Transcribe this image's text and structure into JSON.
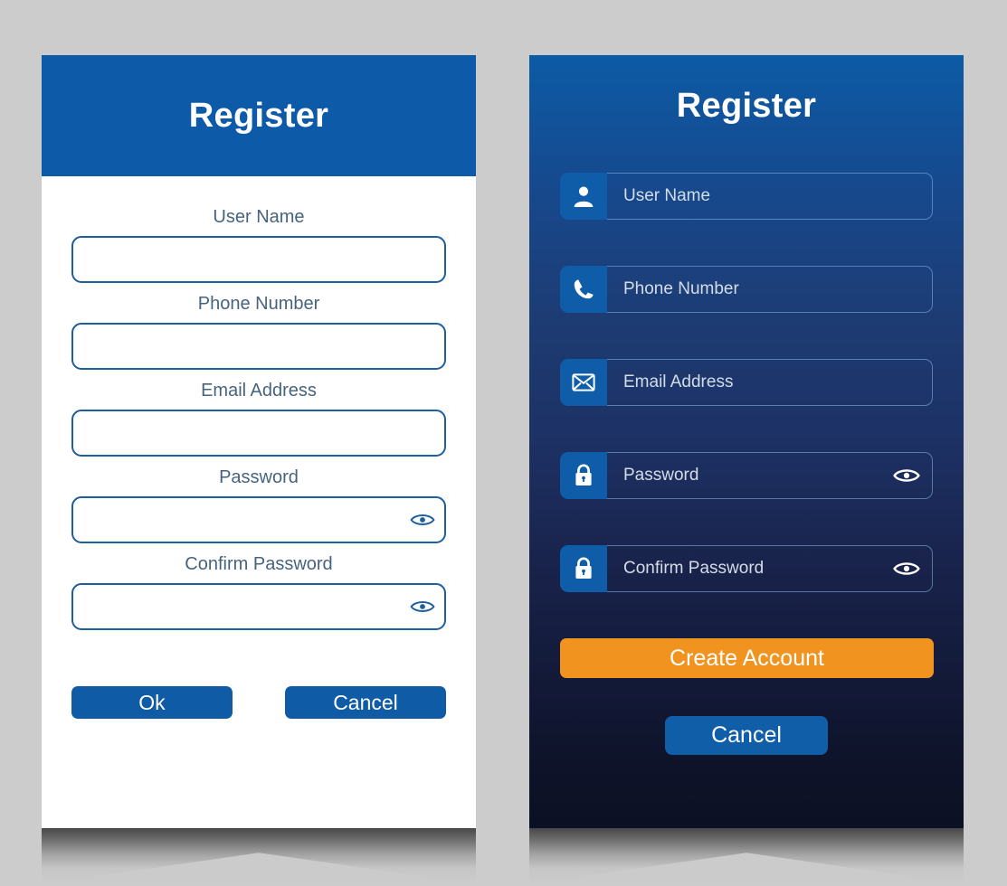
{
  "page": {
    "background_color": "#cccccc",
    "brand_blue": "#0d5ba8",
    "accent_orange": "#f0941f",
    "label_color": "#46637f"
  },
  "light_card": {
    "title": "Register",
    "header_color": "#0d5ba8",
    "fields": [
      {
        "label": "User Name",
        "value": "",
        "placeholder": "",
        "icon": "",
        "has_eye": false
      },
      {
        "label": "Phone Number",
        "value": "",
        "placeholder": "",
        "icon": "",
        "has_eye": false
      },
      {
        "label": "Email Address",
        "value": "",
        "placeholder": "",
        "icon": "",
        "has_eye": false
      },
      {
        "label": "Password",
        "value": "",
        "placeholder": "",
        "icon": "",
        "has_eye": true,
        "eye_icon": "eye-icon"
      },
      {
        "label": "Confirm Password",
        "value": "",
        "placeholder": "",
        "icon": "",
        "has_eye": true,
        "eye_icon": "eye-icon"
      }
    ],
    "buttons": {
      "ok": "Ok",
      "cancel": "Cancel"
    }
  },
  "dark_card": {
    "title": "Register",
    "gradient_top": "#0c5ba6",
    "gradient_bottom": "#0c1024",
    "fields": [
      {
        "placeholder": "User Name",
        "value": "",
        "icon": "user-icon",
        "has_eye": false
      },
      {
        "placeholder": "Phone Number",
        "value": "",
        "icon": "phone-icon",
        "has_eye": false
      },
      {
        "placeholder": "Email Address",
        "value": "",
        "icon": "envelope-icon",
        "has_eye": false
      },
      {
        "placeholder": "Password",
        "value": "",
        "icon": "lock-icon",
        "has_eye": true,
        "eye_icon": "eye-icon"
      },
      {
        "placeholder": "Confirm Password",
        "value": "",
        "icon": "lock-icon",
        "has_eye": true,
        "eye_icon": "eye-icon"
      }
    ],
    "buttons": {
      "create": "Create Account",
      "cancel": "Cancel"
    }
  }
}
